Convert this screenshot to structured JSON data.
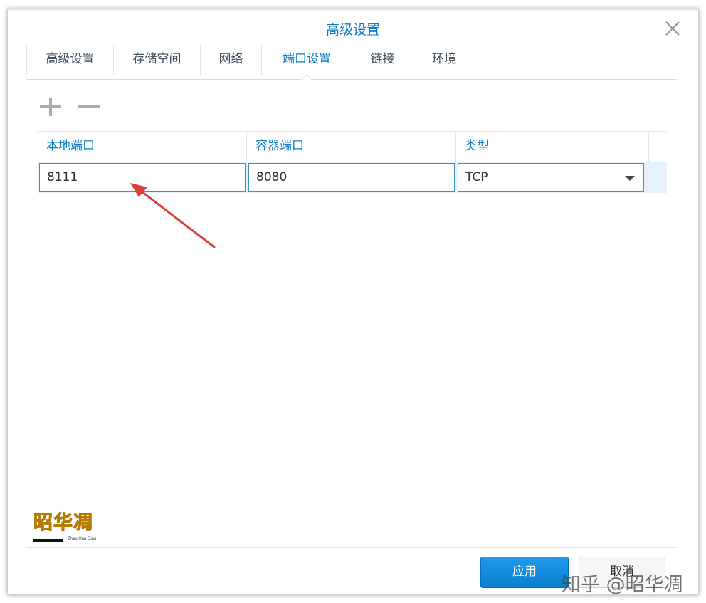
{
  "dialog": {
    "title": "高级设置",
    "close_icon": "close-icon"
  },
  "tabs": [
    {
      "label": "高级设置",
      "active": false
    },
    {
      "label": "存储空间",
      "active": false
    },
    {
      "label": "网络",
      "active": false
    },
    {
      "label": "端口设置",
      "active": true
    },
    {
      "label": "链接",
      "active": false
    },
    {
      "label": "环境",
      "active": false
    }
  ],
  "toolbar": {
    "add_icon": "plus-icon",
    "remove_icon": "minus-icon"
  },
  "grid": {
    "columns": [
      "本地端口",
      "容器端口",
      "类型"
    ],
    "rows": [
      {
        "local_port": "8111",
        "container_port": "8080",
        "type": "TCP"
      }
    ]
  },
  "logo": {
    "text": "昭华凋",
    "subtext": "Zhao Hua Diao"
  },
  "footer": {
    "apply_label": "应用",
    "cancel_label": "取消"
  },
  "watermark": "知乎 @昭华凋",
  "colors": {
    "accent": "#0a7cc4",
    "annotation_arrow": "#d9413a"
  }
}
